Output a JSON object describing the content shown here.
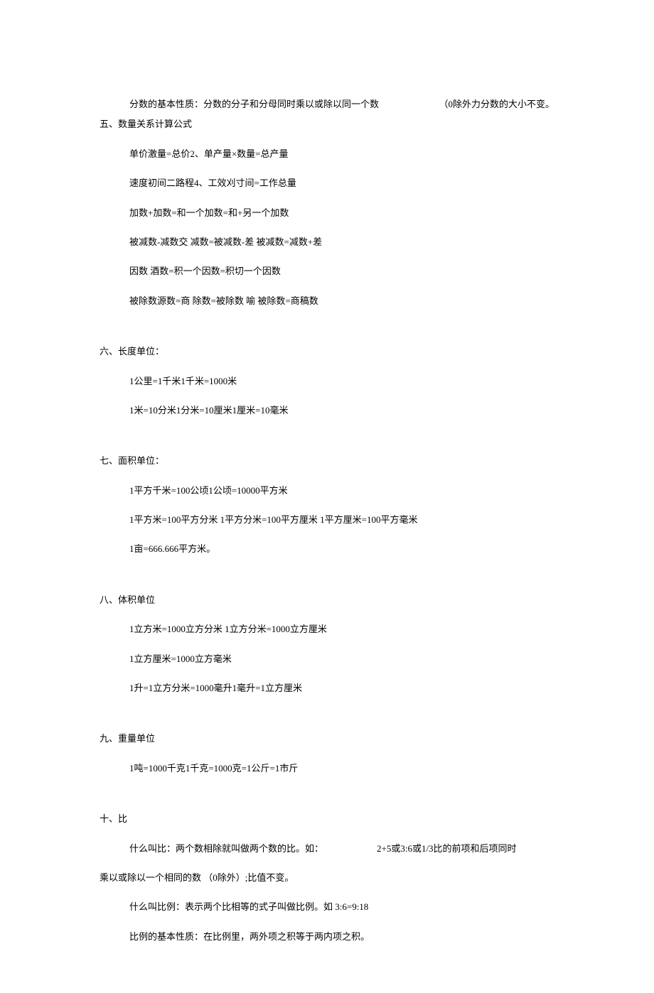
{
  "line1_left": "分数的基本性质：分数的分子和分母同时乘以或除以同一个数",
  "line1_right": "（0除外力分数的大小不变。",
  "heading5": "五、数量关系计算公式",
  "s5_1": "单价激量=总价2、单产量×数量=总产量",
  "s5_2": "速度初间二路程4、工效刈寸间=工作总量",
  "s5_3": "加数+加数=和一个加数=和+另一个加数",
  "s5_4": "被减数-减数交 减数=被减数-差 被减数=减数+差",
  "s5_5": "因数 酒数=积一个因数=积切一个因数",
  "s5_6": "被除数源数=商 除数=被除数 喻 被除数=商稿数",
  "heading6": "六、长度单位：",
  "s6_1": "1公里=1千米1千米=1000米",
  "s6_2": "1米=10分米1分米=10厘米1厘米=10毫米",
  "heading7": "七、面积单位：",
  "s7_1": "1平方千米=100公顷1公顷=10000平方米",
  "s7_2": "1平方米=100平方分米 1平方分米=100平方厘米 1平方厘米=100平方毫米",
  "s7_3": "1亩=666.666平方米。",
  "heading8": "八、体积单位",
  "s8_1": "1立方米=1000立方分米 1立方分米=1000立方厘米",
  "s8_2": "1立方厘米=1000立方毫米",
  "s8_3": "1升=1立方分米=1000毫升1毫升=1立方厘米",
  "heading9": "九、重量单位",
  "s9_1": "1吨=1000千克1千克=1000克=1公斤=1市斤",
  "heading10": "十、比",
  "s10_1_left": "什么叫比：两个数相除就叫做两个数的比。如：",
  "s10_1_right": "2+5或3:6或1/3比的前项和后项同时",
  "s10_2": "乘以或除以一个相同的数 （0除外）;比值不变。",
  "s10_3": "什么叫比例：表示两个比相等的式子叫做比例。如 3:6=9:18",
  "s10_4": "比例的基本性质：在比例里，两外项之积等于两内项之积。"
}
